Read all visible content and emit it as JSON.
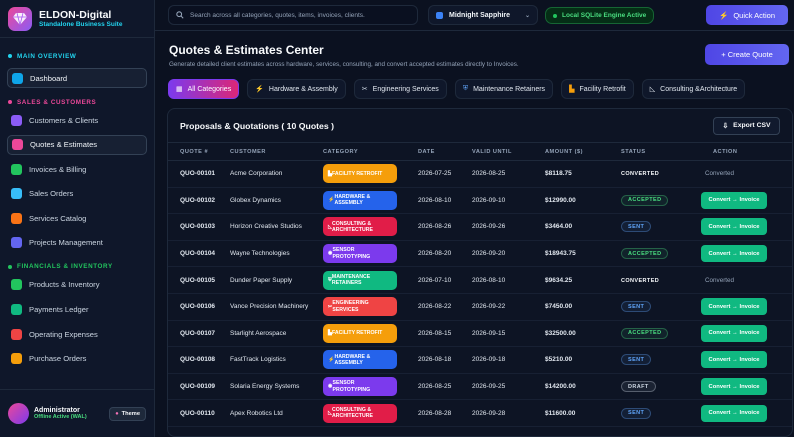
{
  "brand": {
    "title": "ELDON-Digital",
    "subtitle": "Standalone Business Suite"
  },
  "sidebar": {
    "sections": [
      {
        "label": "MAIN OVERVIEW",
        "color": "#22d3ee"
      },
      {
        "label": "SALES & CUSTOMERS",
        "color": "#ec4899"
      },
      {
        "label": "FINANCIALS & INVENTORY",
        "color": "#22c55e"
      }
    ],
    "items": [
      {
        "label": "Dashboard",
        "color": "#0ea5e9"
      },
      {
        "label": "Customers & Clients",
        "color": "#8b5cf6"
      },
      {
        "label": "Quotes & Estimates",
        "color": "#ec4899"
      },
      {
        "label": "Invoices & Billing",
        "color": "#22c55e"
      },
      {
        "label": "Sales Orders",
        "color": "#38bdf8"
      },
      {
        "label": "Services Catalog",
        "color": "#f97316"
      },
      {
        "label": "Projects Management",
        "color": "#6366f1"
      },
      {
        "label": "Products & Inventory",
        "color": "#22c55e"
      },
      {
        "label": "Payments Ledger",
        "color": "#10b981"
      },
      {
        "label": "Operating Expenses",
        "color": "#ef4444"
      },
      {
        "label": "Purchase Orders",
        "color": "#f59e0b"
      }
    ],
    "user": {
      "name": "Administrator",
      "status": "Offline Active (WAL)",
      "theme_label": "Theme"
    }
  },
  "topbar": {
    "search_placeholder": "Search across all categories, quotes, items, invoices, clients.",
    "theme_select": "Midnight Sapphire",
    "engine_status": "Local SQLite Engine Active",
    "quick_action": "Quick Action"
  },
  "page": {
    "title": "Quotes & Estimates Center",
    "description": "Generate detailed client estimates across hardware, services, consulting, and convert accepted estimates directly to Invoices.",
    "create_button": "+ Create Quote"
  },
  "tabs": [
    {
      "label": "All Categories",
      "icon": "grid-icon",
      "glyph": "▦"
    },
    {
      "label": "Hardware & Assembly",
      "icon": "bolt-icon",
      "glyph": "⚡"
    },
    {
      "label": "Engineering Services",
      "icon": "tools-icon",
      "glyph": "✂"
    },
    {
      "label": "Maintenance Retainers",
      "icon": "shield-icon",
      "glyph": "⛨"
    },
    {
      "label": "Facility Retrofit",
      "icon": "building-icon",
      "glyph": "▙"
    },
    {
      "label": "Consulting &Architecture",
      "icon": "ruler-icon",
      "glyph": "◺"
    }
  ],
  "table": {
    "title": "Proposals & Quotations ( 10 Quotes )",
    "export_label": "Export CSV",
    "columns": [
      "QUOTE #",
      "CUSTOMER",
      "CATEGORY",
      "DATE",
      "VALID UNTIL",
      "AMOUNT ($)",
      "STATUS",
      "ACTION"
    ],
    "rows": [
      {
        "id": "QUO-00101",
        "customer": "Acme Corporation",
        "category": "FACILITY RETROFIT",
        "cat_color": "#f59e0b",
        "date": "2026-07-25",
        "valid": "2026-08-25",
        "amount": "$8118.75",
        "status": "CONVERTED",
        "action": "Converted"
      },
      {
        "id": "QUO-00102",
        "customer": "Globex Dynamics",
        "category": "HARDWARE & ASSEMBLY",
        "cat_color": "#2563eb",
        "date": "2026-08-10",
        "valid": "2026-09-10",
        "amount": "$12990.00",
        "status": "ACCEPTED",
        "action": "Convert → Invoice"
      },
      {
        "id": "QUO-00103",
        "customer": "Horizon Creative Studios",
        "category": "CONSULTING & ARCHITECTURE",
        "cat_color": "#e11d48",
        "date": "2026-08-26",
        "valid": "2026-09-26",
        "amount": "$3464.00",
        "status": "SENT",
        "action": "Convert → Invoice"
      },
      {
        "id": "QUO-00104",
        "customer": "Wayne Technologies",
        "category": "SENSOR PROTOTYPING",
        "cat_color": "#7c3aed",
        "date": "2026-08-20",
        "valid": "2026-09-20",
        "amount": "$18943.75",
        "status": "ACCEPTED",
        "action": "Convert → Invoice"
      },
      {
        "id": "QUO-00105",
        "customer": "Dunder Paper Supply",
        "category": "MAINTENANCE RETAINERS",
        "cat_color": "#10b981",
        "date": "2026-07-10",
        "valid": "2026-08-10",
        "amount": "$9634.25",
        "status": "CONVERTED",
        "action": "Converted"
      },
      {
        "id": "QUO-00106",
        "customer": "Vance Precision Machinery",
        "category": "ENGINEERING SERVICES",
        "cat_color": "#ef4444",
        "date": "2026-08-22",
        "valid": "2026-09-22",
        "amount": "$7450.00",
        "status": "SENT",
        "action": "Convert → Invoice"
      },
      {
        "id": "QUO-00107",
        "customer": "Starlight Aerospace",
        "category": "FACILITY RETROFIT",
        "cat_color": "#f59e0b",
        "date": "2026-08-15",
        "valid": "2026-09-15",
        "amount": "$32500.00",
        "status": "ACCEPTED",
        "action": "Convert → Invoice"
      },
      {
        "id": "QUO-00108",
        "customer": "FastTrack Logistics",
        "category": "HARDWARE & ASSEMBLY",
        "cat_color": "#2563eb",
        "date": "2026-08-18",
        "valid": "2026-09-18",
        "amount": "$5210.00",
        "status": "SENT",
        "action": "Convert → Invoice"
      },
      {
        "id": "QUO-00109",
        "customer": "Solaria Energy Systems",
        "category": "SENSOR PROTOTYPING",
        "cat_color": "#7c3aed",
        "date": "2026-08-25",
        "valid": "2026-09-25",
        "amount": "$14200.00",
        "status": "DRAFT",
        "action": "Convert → Invoice"
      },
      {
        "id": "QUO-00110",
        "customer": "Apex Robotics Ltd",
        "category": "CONSULTING & ARCHITECTURE",
        "cat_color": "#e11d48",
        "date": "2026-08-28",
        "valid": "2026-09-28",
        "amount": "$11600.00",
        "status": "SENT",
        "action": "Convert → Invoice"
      }
    ]
  },
  "status_colors": {
    "CONVERTED": "#f8fafc",
    "ACCEPTED": "#4ade80",
    "SENT": "#60a5fa",
    "DRAFT": "#cbd5e1"
  }
}
